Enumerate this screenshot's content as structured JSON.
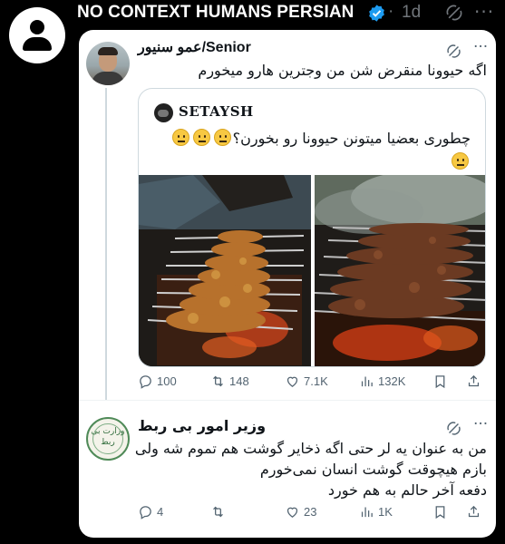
{
  "outer_post": {
    "author": "NO CONTEXT HUMANS PERSIAN",
    "separator": "·",
    "time": "1d",
    "more": "···"
  },
  "tweet1": {
    "author": "عمو سنیور/Senior",
    "more": "···",
    "text": "اگه حیوونا منقرض شن من وجترین هارو میخورم",
    "quote": {
      "author": "SETAYSH",
      "text": "چطوری بعضیا میتونن حیوونا رو بخورن؟"
    },
    "actions": {
      "replies": "100",
      "reposts": "148",
      "likes": "7.1K",
      "views": "132K"
    }
  },
  "tweet2": {
    "author": "وزیر امور بی ربط",
    "avatar_label": "وزارت بی ربط",
    "more": "···",
    "lines": [
      "من به عنوان یه لر حتی اگه ذخایر گوشت هم تموم شه ولی",
      "بازم هیچوقت گوشت انسان نمی‌خورم",
      "دفعه آخر حالم به هم خورد"
    ],
    "actions": {
      "replies": "4",
      "reposts": "",
      "likes": "23",
      "views": "1K"
    }
  },
  "colors": {
    "verified": "#1d9bf0",
    "muted": "#536471",
    "border": "#cfd9de"
  },
  "icons": [
    "verified-badge-icon",
    "grok-icon",
    "more-icon",
    "reply-icon",
    "repost-icon",
    "like-icon",
    "views-icon",
    "bookmark-icon",
    "share-icon"
  ]
}
